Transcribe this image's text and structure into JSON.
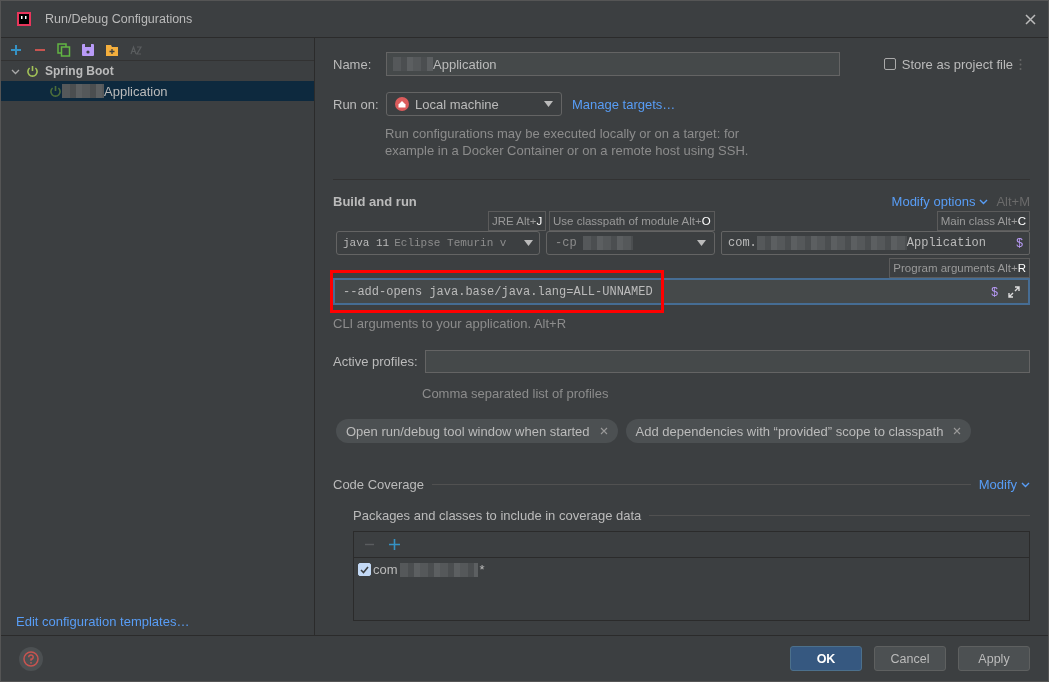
{
  "window": {
    "title": "Run/Debug Configurations"
  },
  "tree": [
    {
      "label": "Spring Boot",
      "expanded": true,
      "children": [
        {
          "label": "Application",
          "redacted": true,
          "selected": true
        }
      ]
    }
  ],
  "edit_templates_link": "Edit configuration templates…",
  "name": {
    "label": "Name:",
    "value": "Application",
    "redacted": true
  },
  "store_as_project_file": {
    "label": "Store as project file",
    "checked": false
  },
  "run_on": {
    "label": "Run on:",
    "target": "Local machine",
    "link": "Manage targets…",
    "hint": "Run configurations may be executed locally or on a target: for example in a Docker Container or on a remote host using SSH."
  },
  "build_and_run": {
    "title": "Build and run",
    "modify_link": "Modify options",
    "modify_shortcut": "Alt+M",
    "jre": "java 11",
    "jre_detail": "Eclipse Temurin v",
    "classpath": "-cp",
    "main_class_prefix": "com.",
    "main_class": "Application",
    "main_class_macro": "$",
    "arguments_macro": "$",
    "program_arguments": "--add-opens java.base/java.lang=ALL-UNNAMED",
    "highlighted": true,
    "hint": "CLI arguments to your application. Alt+R",
    "tooltips": [
      {
        "text": "JRE Alt+**J**",
        "kind": "jre"
      },
      {
        "text": "Use classpath of module Alt+**O**",
        "kind": "classpath"
      },
      {
        "text": "Main class Alt+**C**",
        "kind": "main"
      },
      {
        "text": "Program arguments Alt+**R**",
        "kind": "args"
      }
    ]
  },
  "active_profiles": {
    "label": "Active profiles:",
    "hint": "Comma separated list of profiles"
  },
  "chips": [
    {
      "label": "Open run/debug tool window when started"
    },
    {
      "label": "Add dependencies with “provided” scope to classpath"
    }
  ],
  "code_coverage": {
    "title": "Code Coverage",
    "modify_link": "Modify",
    "packages_title": "Packages and classes to include in coverage data",
    "entries": [
      {
        "prefix": "com",
        "suffix": "*",
        "checked": true
      }
    ]
  },
  "buttons": [
    {
      "label": "OK",
      "kind": "primary"
    },
    {
      "label": "Cancel",
      "kind": "normal"
    },
    {
      "label": "Apply",
      "kind": "normal"
    }
  ]
}
